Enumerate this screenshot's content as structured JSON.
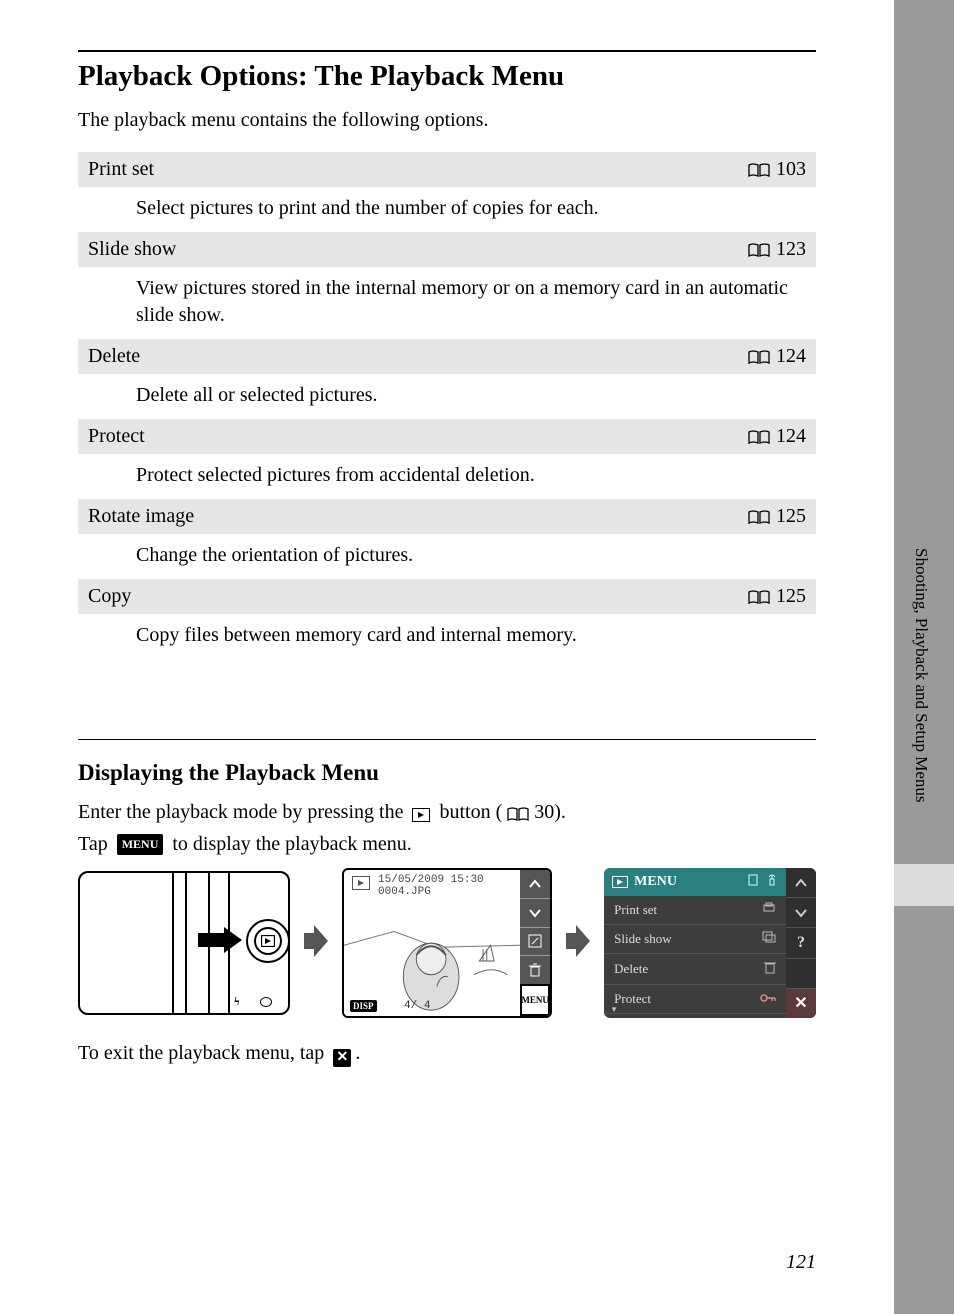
{
  "page": {
    "number": "121",
    "sideLabel": "Shooting, Playback and Setup Menus"
  },
  "heading": "Playback Options: The Playback Menu",
  "intro": "The playback menu contains the following options.",
  "options": [
    {
      "name": "Print set",
      "page": "103",
      "desc": "Select pictures to print and the number of copies for each."
    },
    {
      "name": "Slide show",
      "page": "123",
      "desc": "View pictures stored in the internal memory or on a memory card in an automatic slide show."
    },
    {
      "name": "Delete",
      "page": "124",
      "desc": "Delete all or selected pictures."
    },
    {
      "name": "Protect",
      "page": "124",
      "desc": "Protect selected pictures from accidental deletion."
    },
    {
      "name": "Rotate image",
      "page": "125",
      "desc": "Change the orientation of pictures."
    },
    {
      "name": "Copy",
      "page": "125",
      "desc": "Copy files between memory card and internal memory."
    }
  ],
  "display": {
    "heading": "Displaying the Playback Menu",
    "line1a": "Enter the playback mode by pressing the ",
    "line1b": " button (",
    "line1c": " 30).",
    "line2a": "Tap ",
    "line2b": " to display the playback menu.",
    "menuLabel": "MENU",
    "exit_a": "To exit the playback menu, tap ",
    "exit_b": "."
  },
  "fig2": {
    "timestamp": "15/05/2009 15:30",
    "filename": "0004.JPG",
    "disp": "DISP",
    "counter": "4/    4",
    "menu": "MENU"
  },
  "fig3": {
    "title": "MENU",
    "items": [
      {
        "label": "Print set"
      },
      {
        "label": "Slide show"
      },
      {
        "label": "Delete"
      },
      {
        "label": "Protect"
      }
    ]
  }
}
